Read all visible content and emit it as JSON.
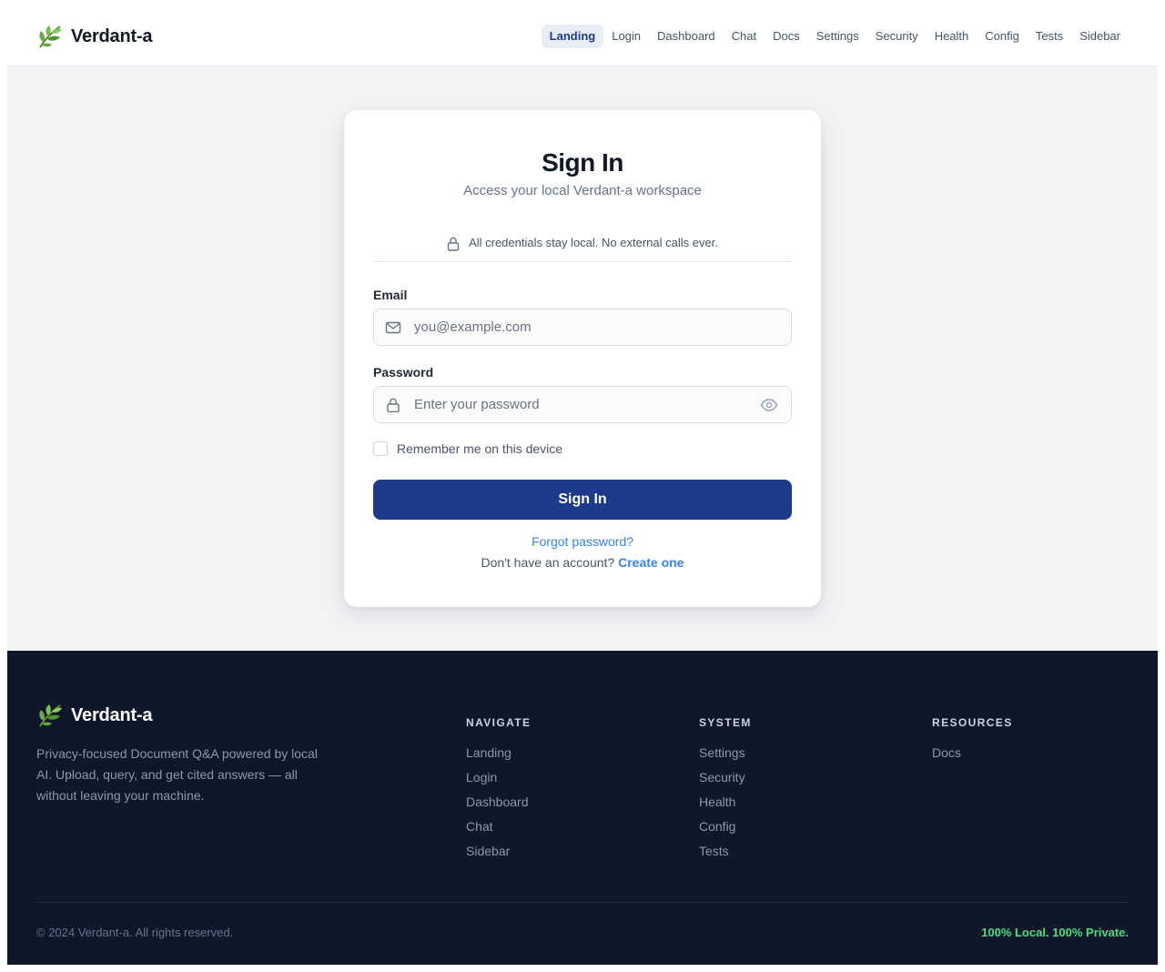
{
  "brand": {
    "name": "Verdant-a",
    "icon": "leaf-icon"
  },
  "nav": {
    "items": [
      {
        "label": "Landing",
        "active": true
      },
      {
        "label": "Login"
      },
      {
        "label": "Dashboard"
      },
      {
        "label": "Chat"
      },
      {
        "label": "Docs"
      },
      {
        "label": "Settings"
      },
      {
        "label": "Security"
      },
      {
        "label": "Health"
      },
      {
        "label": "Config"
      },
      {
        "label": "Tests"
      },
      {
        "label": "Sidebar"
      }
    ]
  },
  "login": {
    "title": "Sign In",
    "subtitle": "Access your local Verdant-a workspace",
    "notice": "All credentials stay local. No external calls ever.",
    "email_label": "Email",
    "email_placeholder": "you@example.com",
    "email_value": "",
    "password_label": "Password",
    "password_placeholder": "Enter your password",
    "password_value": "",
    "remember_label": "Remember me on this device",
    "remember_checked": false,
    "submit_label": "Sign In",
    "forgot_label": "Forgot password?",
    "signup_prompt": "Don't have an account?",
    "signup_link": "Create one"
  },
  "footer": {
    "brand": "Verdant-a",
    "description": "Privacy-focused Document Q&A powered by local AI. Upload, query, and get cited answers — all without leaving your machine.",
    "columns": [
      {
        "heading": "NAVIGATE",
        "links": [
          "Landing",
          "Login",
          "Dashboard",
          "Chat",
          "Sidebar"
        ]
      },
      {
        "heading": "SYSTEM",
        "links": [
          "Settings",
          "Security",
          "Health",
          "Config",
          "Tests"
        ]
      },
      {
        "heading": "RESOURCES",
        "links": [
          "Docs"
        ]
      }
    ],
    "copyright": "© 2024 Verdant-a. All rights reserved.",
    "tagline": "100% Local. 100% Private."
  },
  "colors": {
    "primary": "#1e3a8a",
    "link": "#3b82f6",
    "footer_bg": "#0f172a",
    "tagline": "#4ade80",
    "page_bg": "#f2f3f5"
  }
}
